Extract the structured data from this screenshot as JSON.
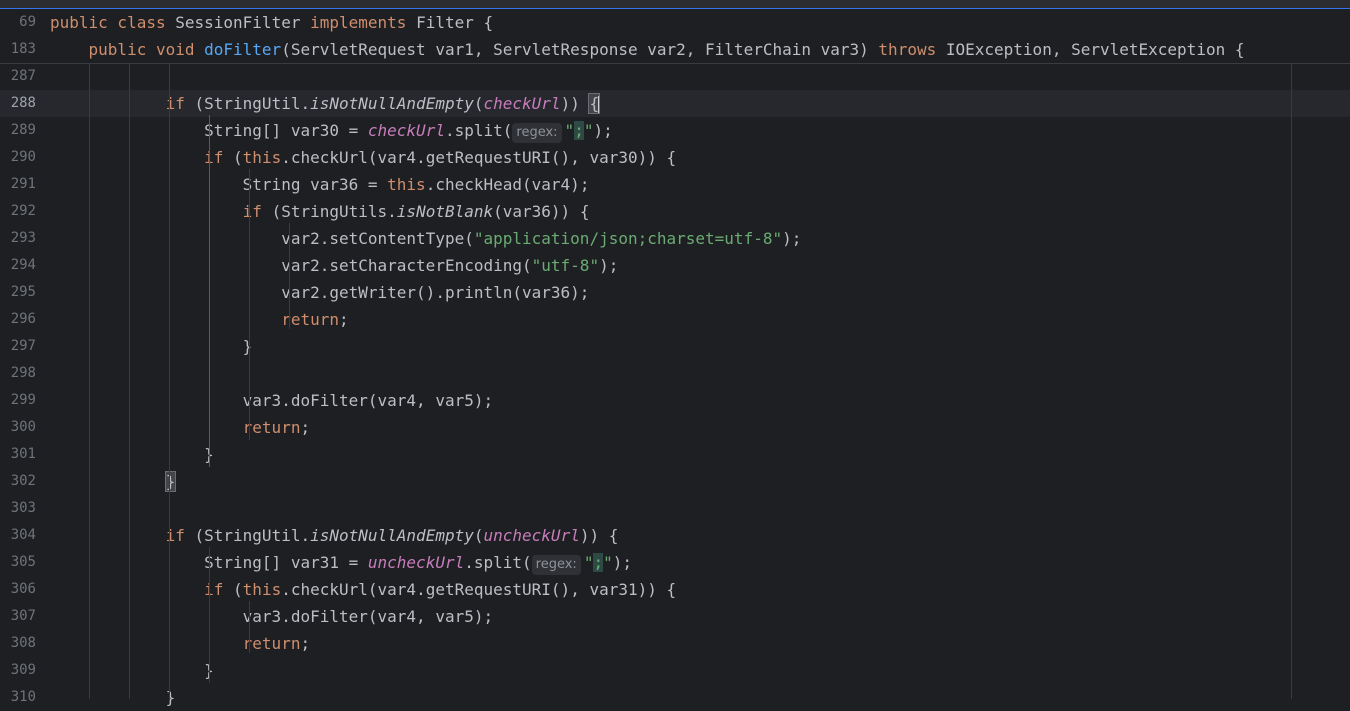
{
  "editor": {
    "sticky_lines": [
      {
        "number": "69",
        "parts": [
          {
            "t": "public class ",
            "c": "kw"
          },
          {
            "t": "SessionFilter ",
            "c": ""
          },
          {
            "t": "implements ",
            "c": "kw"
          },
          {
            "t": "Filter {",
            "c": ""
          }
        ]
      },
      {
        "number": "183",
        "parts": [
          {
            "t": "    public void ",
            "c": "kw"
          },
          {
            "t": "doFilter",
            "c": "fn"
          },
          {
            "t": "(ServletRequest var1, ServletResponse var2, FilterChain var3) ",
            "c": ""
          },
          {
            "t": "throws ",
            "c": "kw"
          },
          {
            "t": "IOException, ServletException {",
            "c": ""
          }
        ]
      }
    ],
    "lines": [
      {
        "number": "287",
        "parts": []
      },
      {
        "number": "288",
        "current": true,
        "parts": [
          {
            "t": "            if ",
            "c": "kw"
          },
          {
            "t": "(StringUtil.",
            "c": ""
          },
          {
            "t": "isNotNullAndEmpty",
            "c": "static"
          },
          {
            "t": "(",
            "c": ""
          },
          {
            "t": "checkUrl",
            "c": "field"
          },
          {
            "t": ")) ",
            "c": ""
          },
          {
            "t": "{",
            "c": "brace-hl"
          },
          {
            "cursor": true
          }
        ]
      },
      {
        "number": "289",
        "parts": [
          {
            "t": "                String[] var30 = ",
            "c": ""
          },
          {
            "t": "checkUrl",
            "c": "field"
          },
          {
            "t": ".split(",
            "c": ""
          },
          {
            "hint": "regex:"
          },
          {
            "t": "\"",
            "c": "str"
          },
          {
            "t": ";",
            "c": "str semi-hl"
          },
          {
            "t": "\"",
            "c": "str"
          },
          {
            "t": ");",
            "c": ""
          }
        ]
      },
      {
        "number": "290",
        "parts": [
          {
            "t": "                if ",
            "c": "kw"
          },
          {
            "t": "(",
            "c": ""
          },
          {
            "t": "this",
            "c": "kw"
          },
          {
            "t": ".checkUrl(var4.getRequestURI(), var30)) {",
            "c": ""
          }
        ]
      },
      {
        "number": "291",
        "parts": [
          {
            "t": "                    String var36 = ",
            "c": ""
          },
          {
            "t": "this",
            "c": "kw"
          },
          {
            "t": ".checkHead(var4);",
            "c": ""
          }
        ]
      },
      {
        "number": "292",
        "parts": [
          {
            "t": "                    if ",
            "c": "kw"
          },
          {
            "t": "(StringUtils.",
            "c": ""
          },
          {
            "t": "isNotBlank",
            "c": "static"
          },
          {
            "t": "(var36)) {",
            "c": ""
          }
        ]
      },
      {
        "number": "293",
        "parts": [
          {
            "t": "                        var2.setContentType(",
            "c": ""
          },
          {
            "t": "\"application/json;charset=utf-8\"",
            "c": "str"
          },
          {
            "t": ");",
            "c": ""
          }
        ]
      },
      {
        "number": "294",
        "parts": [
          {
            "t": "                        var2.setCharacterEncoding(",
            "c": ""
          },
          {
            "t": "\"utf-8\"",
            "c": "str"
          },
          {
            "t": ");",
            "c": ""
          }
        ]
      },
      {
        "number": "295",
        "parts": [
          {
            "t": "                        var2.getWriter().println(var36);",
            "c": ""
          }
        ]
      },
      {
        "number": "296",
        "parts": [
          {
            "t": "                        return",
            "c": "kw"
          },
          {
            "t": ";",
            "c": ""
          }
        ]
      },
      {
        "number": "297",
        "parts": [
          {
            "t": "                    }",
            "c": ""
          }
        ]
      },
      {
        "number": "298",
        "parts": []
      },
      {
        "number": "299",
        "parts": [
          {
            "t": "                    var3.doFilter(var4, var5);",
            "c": ""
          }
        ]
      },
      {
        "number": "300",
        "parts": [
          {
            "t": "                    return",
            "c": "kw"
          },
          {
            "t": ";",
            "c": ""
          }
        ]
      },
      {
        "number": "301",
        "parts": [
          {
            "t": "                }",
            "c": ""
          }
        ]
      },
      {
        "number": "302",
        "parts": [
          {
            "t": "            ",
            "c": ""
          },
          {
            "t": "}",
            "c": "brace-hl"
          }
        ]
      },
      {
        "number": "303",
        "parts": []
      },
      {
        "number": "304",
        "parts": [
          {
            "t": "            if ",
            "c": "kw"
          },
          {
            "t": "(StringUtil.",
            "c": ""
          },
          {
            "t": "isNotNullAndEmpty",
            "c": "static"
          },
          {
            "t": "(",
            "c": ""
          },
          {
            "t": "uncheckUrl",
            "c": "field"
          },
          {
            "t": ")) {",
            "c": ""
          }
        ]
      },
      {
        "number": "305",
        "parts": [
          {
            "t": "                String[] var31 = ",
            "c": ""
          },
          {
            "t": "uncheckUrl",
            "c": "field"
          },
          {
            "t": ".split(",
            "c": ""
          },
          {
            "hint": "regex:"
          },
          {
            "t": "\"",
            "c": "str"
          },
          {
            "t": ";",
            "c": "str semi-hl"
          },
          {
            "t": "\"",
            "c": "str"
          },
          {
            "t": ");",
            "c": ""
          }
        ]
      },
      {
        "number": "306",
        "parts": [
          {
            "t": "                if ",
            "c": "kw"
          },
          {
            "t": "(",
            "c": ""
          },
          {
            "t": "this",
            "c": "kw"
          },
          {
            "t": ".checkUrl(var4.getRequestURI(), var31)) {",
            "c": ""
          }
        ]
      },
      {
        "number": "307",
        "parts": [
          {
            "t": "                    var3.doFilter(var4, var5);",
            "c": ""
          }
        ]
      },
      {
        "number": "308",
        "parts": [
          {
            "t": "                    return",
            "c": "kw"
          },
          {
            "t": ";",
            "c": ""
          }
        ]
      },
      {
        "number": "309",
        "parts": [
          {
            "t": "                }",
            "c": ""
          }
        ]
      },
      {
        "number": "310",
        "parts": [
          {
            "t": "            }",
            "c": ""
          }
        ]
      }
    ]
  },
  "colors": {
    "background": "#1e1f22",
    "keyword": "#cf8e6d",
    "method": "#56a8f5",
    "string": "#6aab73",
    "field": "#c77dbb",
    "line_number": "#6f737a"
  }
}
